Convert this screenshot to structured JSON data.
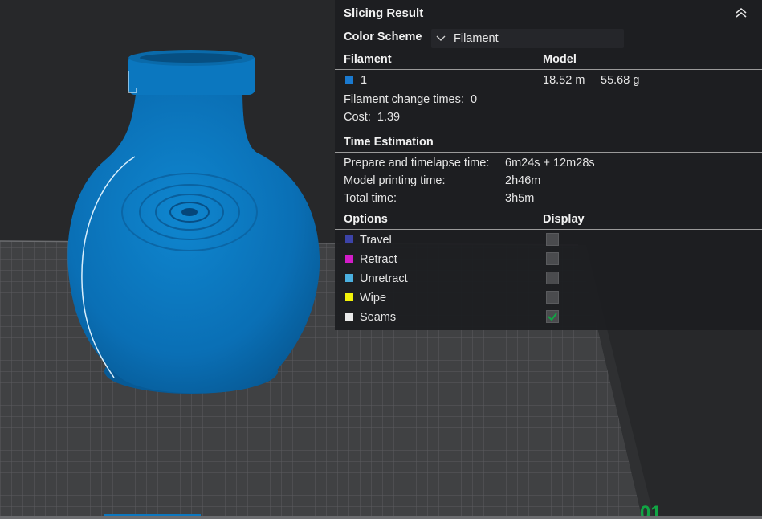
{
  "panel": {
    "title": "Slicing Result",
    "color_scheme": {
      "label": "Color Scheme",
      "value": "Filament"
    },
    "filament_section": {
      "col_filament": "Filament",
      "col_model": "Model",
      "rows": [
        {
          "id": "1",
          "color": "#1a7ad0",
          "length": "18.52 m",
          "weight": "55.68 g"
        }
      ],
      "change_times_label": "Filament change times:",
      "change_times_value": "0",
      "cost_label": "Cost:",
      "cost_value": "1.39"
    },
    "time_section": {
      "title": "Time Estimation",
      "prepare_label": "Prepare and timelapse time:",
      "prepare_value": "6m24s + 12m28s",
      "model_label": "Model printing time:",
      "model_value": "2h46m",
      "total_label": "Total time:",
      "total_value": "3h5m"
    },
    "options_section": {
      "col_options": "Options",
      "col_display": "Display",
      "items": [
        {
          "label": "Travel",
          "color": "#3c43a8",
          "checked": false
        },
        {
          "label": "Retract",
          "color": "#d21cc8",
          "checked": false
        },
        {
          "label": "Unretract",
          "color": "#4bb0e0",
          "checked": false
        },
        {
          "label": "Wipe",
          "color": "#f2f20a",
          "checked": false
        },
        {
          "label": "Seams",
          "color": "#eaeaea",
          "checked": true
        }
      ]
    }
  },
  "viewport": {
    "plate_label": "01",
    "model_color": "#0a72b9",
    "bed_color": "#414244",
    "accent_color": "#11a544"
  }
}
